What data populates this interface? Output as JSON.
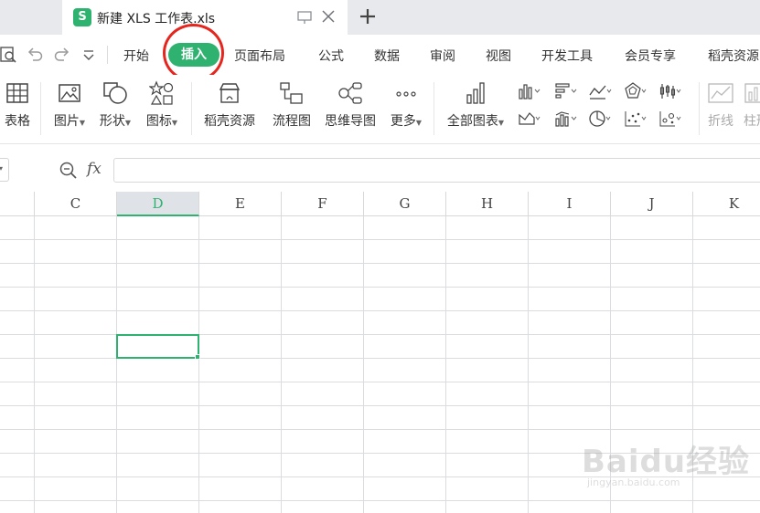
{
  "tab": {
    "icon_letter": "S",
    "title": "新建 XLS 工作表.xls"
  },
  "menu": {
    "items": [
      "开始",
      "插入",
      "页面布局",
      "公式",
      "数据",
      "审阅",
      "视图",
      "开发工具",
      "会员专享",
      "稻壳资源"
    ],
    "active": "插入",
    "accent_color": "#2fb170",
    "highlight_color": "#e5261f"
  },
  "ribbon": {
    "table": "表格",
    "picture": "图片",
    "shape": "形状",
    "icon": "图标",
    "docer_resources": "稻壳资源",
    "flowchart": "流程图",
    "mindmap": "思维导图",
    "more": "更多",
    "all_charts": "全部图表",
    "line_chart": "折线",
    "column_chart": "柱形"
  },
  "formula_bar": {
    "fx": "fx",
    "value": ""
  },
  "sheet": {
    "columns": [
      "C",
      "D",
      "E",
      "F",
      "G",
      "H",
      "I",
      "J",
      "K"
    ],
    "selected_column": "D"
  },
  "watermark": {
    "main": "Baidu经验",
    "sub": "jingyan.baidu.com"
  }
}
